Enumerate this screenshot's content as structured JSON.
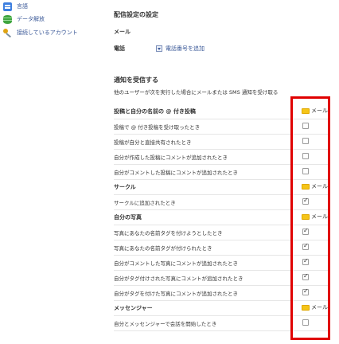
{
  "sidebar": {
    "items": [
      {
        "label": "言語",
        "icon": "language-icon"
      },
      {
        "label": "データ解放",
        "icon": "database-icon"
      },
      {
        "label": "接続しているアカウント",
        "icon": "key-icon"
      }
    ]
  },
  "delivery": {
    "title": "配信設定の設定",
    "email_label": "メール",
    "phone_label": "電話",
    "add_phone_link": "電話番号を追加"
  },
  "notifications": {
    "title": "通知を受信する",
    "description": "他のユーザーが次を実行した場合にメールまたは SMS 通知を受け取る",
    "mail_label": "メール",
    "groups": [
      {
        "title": "投稿と自分の名前の @ 付き投稿",
        "items": [
          {
            "label": "投稿で @ 付き投稿を受け取ったとき",
            "checked": false
          },
          {
            "label": "投稿が自分と直接共有されたとき",
            "checked": false
          },
          {
            "label": "自分が作成した投稿にコメントが追加されたとき",
            "checked": false
          },
          {
            "label": "自分がコメントした投稿にコメントが追加されたとき",
            "checked": false
          }
        ]
      },
      {
        "title": "サークル",
        "items": [
          {
            "label": "サークルに追加されたとき",
            "checked": true
          }
        ]
      },
      {
        "title": "自分の写真",
        "items": [
          {
            "label": "写真にあなたの名前タグを付けようとしたとき",
            "checked": true
          },
          {
            "label": "写真にあなたの名前タグが付けられたとき",
            "checked": true
          },
          {
            "label": "自分がコメントした写真にコメントが追加されたとき",
            "checked": true
          },
          {
            "label": "自分がタグ付けされた写真にコメントが追加されたとき",
            "checked": true
          },
          {
            "label": "自分がタグを付けた写真にコメントが追加されたとき",
            "checked": true
          }
        ]
      },
      {
        "title": "メッセンジャー",
        "items": [
          {
            "label": "自分とメッセンジャーで会話を開始したとき",
            "checked": false
          }
        ]
      }
    ]
  },
  "colors": {
    "link": "#3b5998",
    "highlight_box": "#e00000",
    "mail_icon": "#f5c518"
  }
}
